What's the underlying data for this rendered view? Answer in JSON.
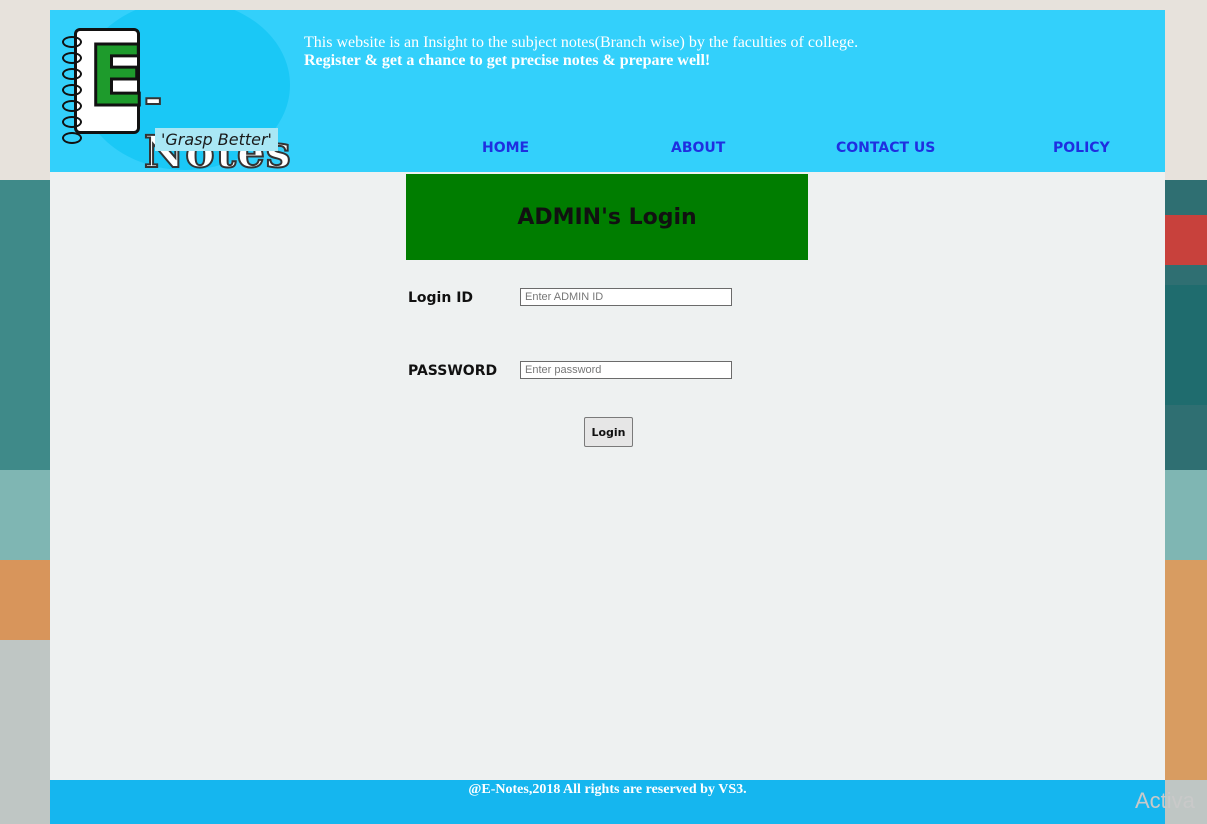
{
  "header": {
    "logo_text": "E-Notes",
    "logo_letter": "E",
    "logo_rest": "-Notes",
    "tagline": "'Grasp Better'",
    "intro_line1": "This website is an Insight to the subject notes(Branch wise) by the faculties of college.",
    "intro_line2": "Register & get a chance to get precise notes & prepare well!"
  },
  "nav": {
    "home": "HOME",
    "about": "ABOUT",
    "contact": "CONTACT US",
    "policy": "POLICY"
  },
  "login": {
    "title": "ADMIN's Login",
    "id_label": "Login ID",
    "id_placeholder": "Enter ADMIN ID",
    "password_label": "PASSWORD",
    "password_placeholder": "Enter password",
    "button": "Login"
  },
  "footer": {
    "text": "@E-Notes,2018 All rights are reserved by VS3."
  },
  "watermark": "Activa",
  "colors": {
    "header_bg": "#33d0fb",
    "banner_bg": "#007d00",
    "nav_link": "#1f2fe0",
    "footer_bg": "#15b6ef"
  }
}
